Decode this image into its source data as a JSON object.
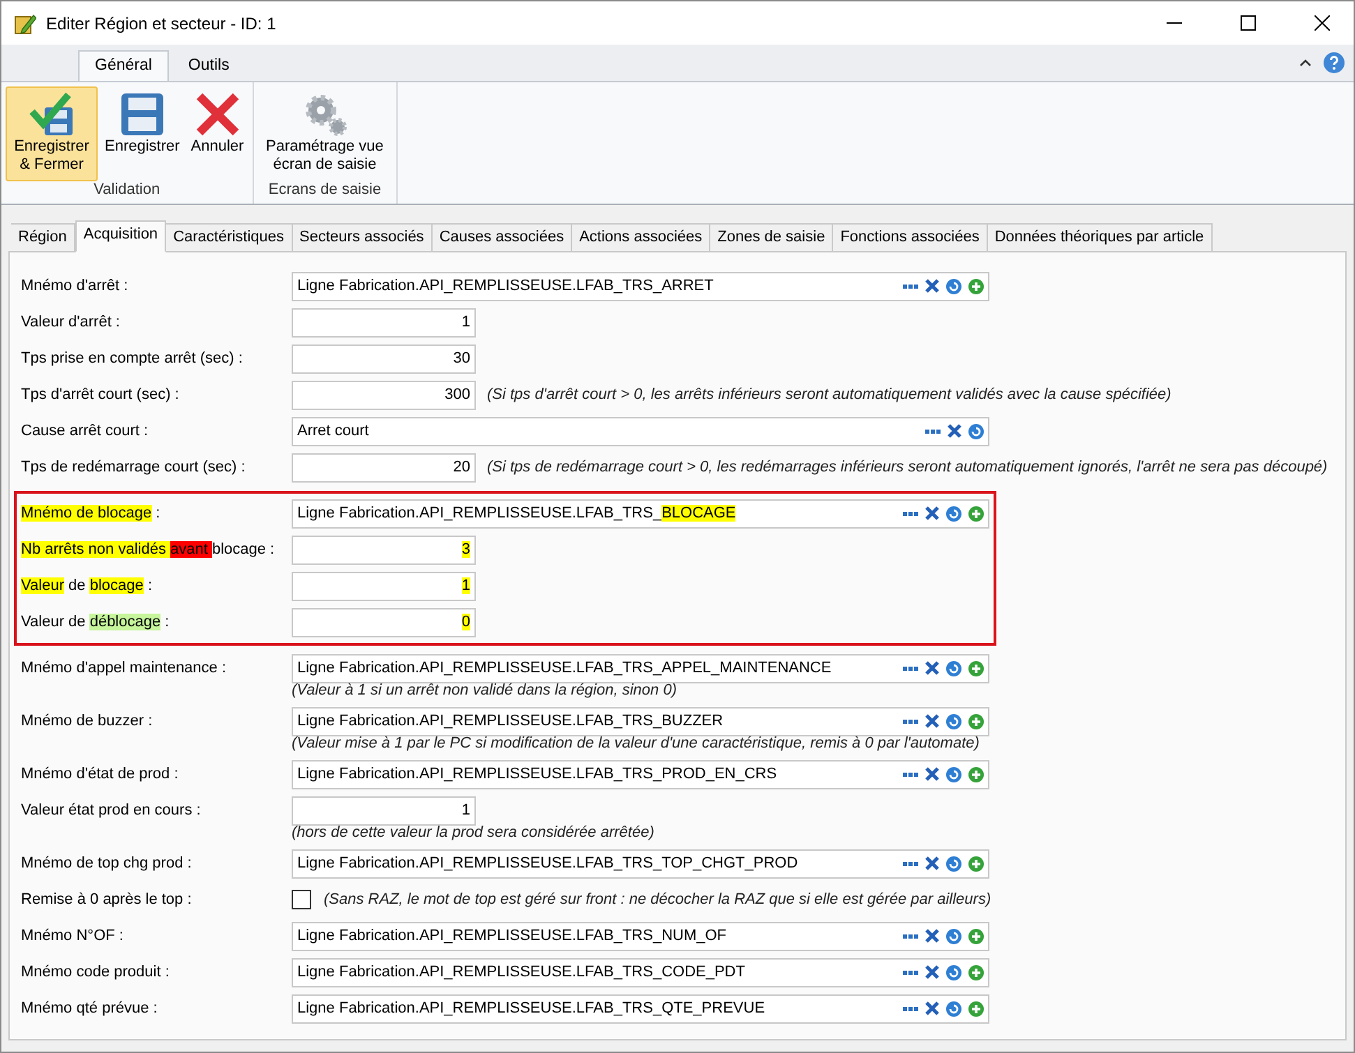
{
  "window": {
    "title": "Editer Région et secteur - ID: 1"
  },
  "ribbon": {
    "tabs": [
      {
        "label": "Général",
        "selected": true
      },
      {
        "label": "Outils",
        "selected": false
      }
    ],
    "groups": [
      {
        "label": "Validation",
        "buttons": [
          {
            "kind": "save-close",
            "label": "Enregistrer & Fermer",
            "active": true
          },
          {
            "kind": "save",
            "label": "Enregistrer",
            "active": false
          },
          {
            "kind": "cancel",
            "label": "Annuler",
            "active": false
          }
        ]
      },
      {
        "label": "Ecrans de saisie",
        "buttons": [
          {
            "kind": "settings",
            "label": "Paramétrage vue écran de saisie",
            "active": false
          }
        ]
      }
    ]
  },
  "form_tabs": [
    {
      "label": "Région",
      "selected": false
    },
    {
      "label": "Acquisition",
      "selected": true
    },
    {
      "label": "Caractéristiques",
      "selected": false
    },
    {
      "label": "Secteurs associés",
      "selected": false
    },
    {
      "label": "Causes associées",
      "selected": false
    },
    {
      "label": "Actions associées",
      "selected": false
    },
    {
      "label": "Zones de saisie",
      "selected": false
    },
    {
      "label": "Fonctions associées",
      "selected": false
    },
    {
      "label": "Données théoriques par article",
      "selected": false
    }
  ],
  "sections": [
    {
      "rows": [
        {
          "kind": "mnemo",
          "label": [
            {
              "text": "Mnémo d'arrêt :"
            }
          ],
          "value": [
            {
              "text": "Ligne Fabrication.API_REMPLISSEUSE.LFAB_TRS_ARRET"
            }
          ],
          "add_button": true
        },
        {
          "kind": "number",
          "label": [
            {
              "text": "Valeur d'arrêt :"
            }
          ],
          "value": [
            {
              "text": "1"
            }
          ]
        },
        {
          "kind": "number",
          "label": [
            {
              "text": "Tps prise en compte arrêt (sec) :"
            }
          ],
          "value": [
            {
              "text": "30"
            }
          ]
        },
        {
          "kind": "number",
          "label": [
            {
              "text": "Tps d'arrêt court (sec) :"
            }
          ],
          "value": [
            {
              "text": "300"
            }
          ],
          "side_note": "(Si tps d'arrêt court > 0, les arrêts inférieurs seront automatiquement validés avec la cause spécifiée)"
        },
        {
          "kind": "mnemo",
          "label": [
            {
              "text": "Cause arrêt court :"
            }
          ],
          "value": [
            {
              "text": "Arret court"
            }
          ],
          "add_button": false
        },
        {
          "kind": "number",
          "label": [
            {
              "text": "Tps de redémarrage court (sec) :"
            }
          ],
          "value": [
            {
              "text": "20"
            }
          ],
          "side_note": "(Si tps de redémarrage court > 0, les redémarrages inférieurs seront automatiquement ignorés, l'arrêt ne sera pas découpé)"
        }
      ]
    },
    {
      "outlined": true,
      "rows": [
        {
          "kind": "mnemo",
          "label": [
            {
              "text": "Mnémo de blocage",
              "color": "#ffff00"
            },
            {
              "text": " :"
            }
          ],
          "value": [
            {
              "text": "Ligne Fabrication.API_REMPLISSEUSE.LFAB_TRS_"
            },
            {
              "text": "BLOCAGE",
              "color": "#ffff00"
            }
          ],
          "add_button": true
        },
        {
          "kind": "number",
          "label": [
            {
              "text": "Nb arrêts non validés ",
              "color": "#ffff00"
            },
            {
              "text": "avant ",
              "color": "#ff0000"
            },
            {
              "text": "blocage :"
            }
          ],
          "value": [
            {
              "text": "3",
              "color": "#ffff00"
            }
          ]
        },
        {
          "kind": "number",
          "label": [
            {
              "text": "Valeur",
              "color": "#ffff00"
            },
            {
              "text": " de "
            },
            {
              "text": "blocage",
              "color": "#ffff00"
            },
            {
              "text": " :"
            }
          ],
          "value": [
            {
              "text": "1",
              "color": "#ffff00"
            }
          ]
        },
        {
          "kind": "number",
          "label": [
            {
              "text": "Valeur de "
            },
            {
              "text": "déblocage",
              "color": "#c6f59c"
            },
            {
              "text": " :"
            }
          ],
          "value": [
            {
              "text": "0",
              "color": "#ffff00"
            }
          ]
        }
      ]
    },
    {
      "rows": [
        {
          "kind": "mnemo",
          "label": [
            {
              "text": "Mnémo d'appel maintenance :"
            }
          ],
          "value": [
            {
              "text": "Ligne Fabrication.API_REMPLISSEUSE.LFAB_TRS_APPEL_MAINTENANCE"
            }
          ],
          "add_button": true,
          "note_below": "(Valeur à 1 si un arrêt non validé dans la région, sinon 0)"
        },
        {
          "kind": "mnemo",
          "label": [
            {
              "text": "Mnémo de buzzer :"
            }
          ],
          "value": [
            {
              "text": "Ligne Fabrication.API_REMPLISSEUSE.LFAB_TRS_BUZZER"
            }
          ],
          "add_button": true,
          "note_below": "(Valeur mise à 1 par le PC si modification de la valeur d'une caractéristique, remis à 0 par l'automate)"
        },
        {
          "kind": "mnemo",
          "label": [
            {
              "text": "Mnémo d'état de prod :"
            }
          ],
          "value": [
            {
              "text": "Ligne Fabrication.API_REMPLISSEUSE.LFAB_TRS_PROD_EN_CRS"
            }
          ],
          "add_button": true
        },
        {
          "kind": "number",
          "label": [
            {
              "text": "Valeur état prod en cours :"
            }
          ],
          "value": [
            {
              "text": "1"
            }
          ],
          "note_below": "(hors de cette valeur la prod sera considérée arrêtée)"
        },
        {
          "kind": "mnemo",
          "label": [
            {
              "text": "Mnémo de top chg prod :"
            }
          ],
          "value": [
            {
              "text": "Ligne Fabrication.API_REMPLISSEUSE.LFAB_TRS_TOP_CHGT_PROD"
            }
          ],
          "add_button": true
        },
        {
          "kind": "check",
          "label": [
            {
              "text": "Remise à 0 après le top :"
            }
          ],
          "checked": false,
          "side_note": "(Sans RAZ, le mot de top est géré sur front : ne décocher la RAZ que si elle est gérée par ailleurs)"
        },
        {
          "kind": "mnemo",
          "label": [
            {
              "text": "Mnémo N°OF :"
            }
          ],
          "value": [
            {
              "text": "Ligne Fabrication.API_REMPLISSEUSE.LFAB_TRS_NUM_OF"
            }
          ],
          "add_button": true
        },
        {
          "kind": "mnemo",
          "label": [
            {
              "text": "Mnémo code produit :"
            }
          ],
          "value": [
            {
              "text": "Ligne Fabrication.API_REMPLISSEUSE.LFAB_TRS_CODE_PDT"
            }
          ],
          "add_button": true
        },
        {
          "kind": "mnemo",
          "label": [
            {
              "text": "Mnémo qté prévue :"
            }
          ],
          "value": [
            {
              "text": "Ligne Fabrication.API_REMPLISSEUSE.LFAB_TRS_QTE_PREVUE"
            }
          ],
          "add_button": true
        }
      ]
    }
  ]
}
